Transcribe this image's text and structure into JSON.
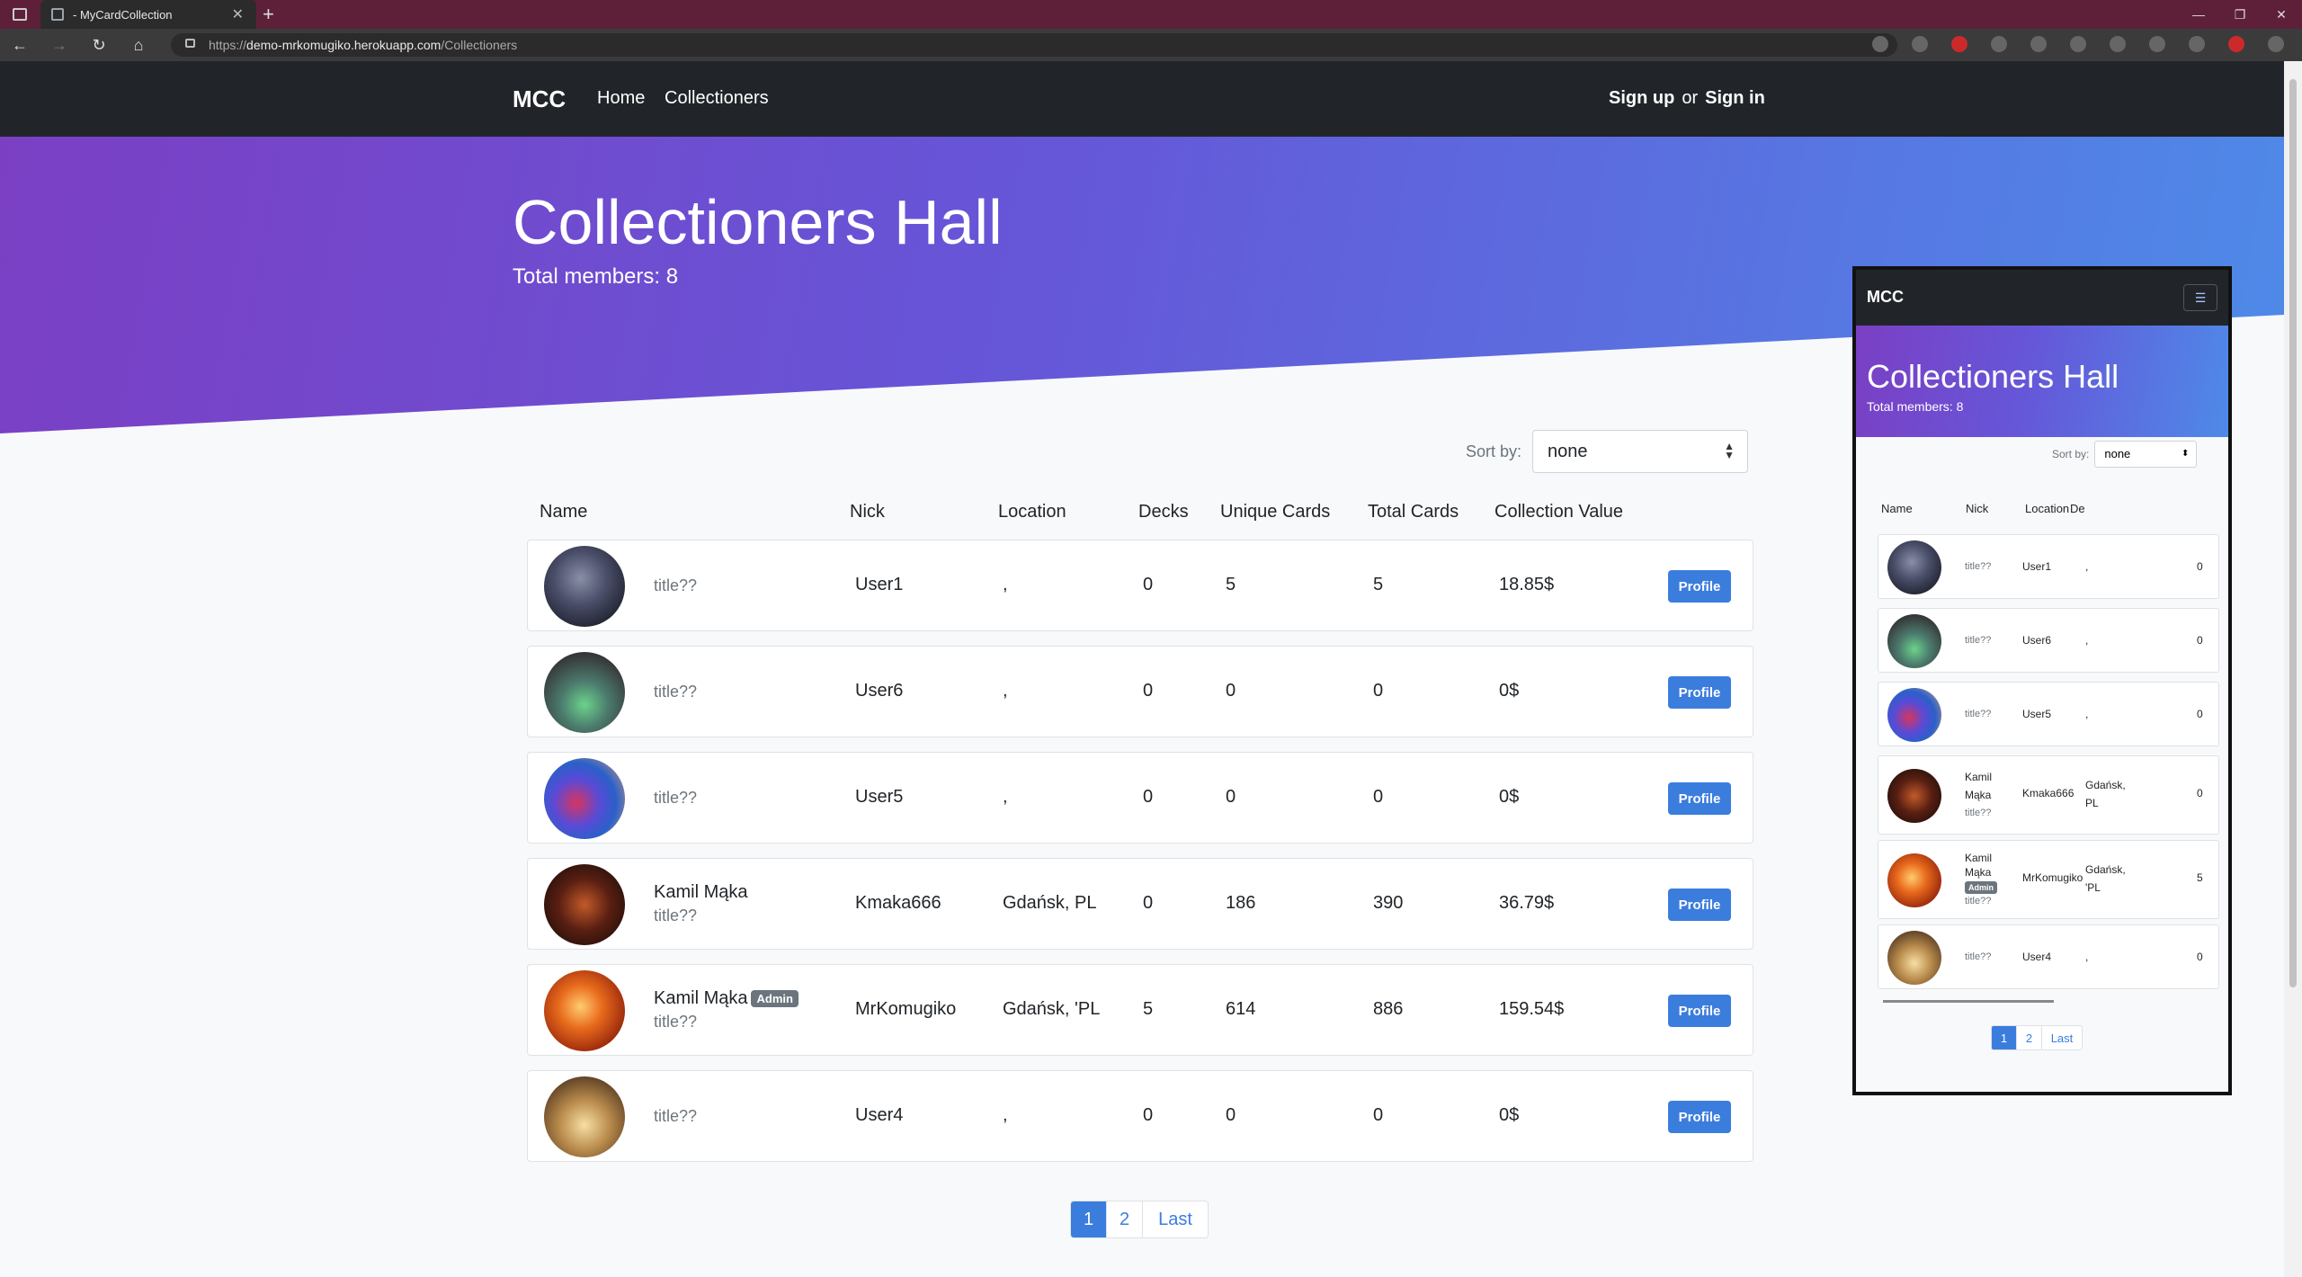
{
  "browser": {
    "tab_title": "- MyCardCollection",
    "url_prefix": "https://",
    "url_host": "demo-mrkomugiko.herokuapp.com",
    "url_path": "/Collectioners"
  },
  "navbar": {
    "brand": "MCC",
    "links": [
      "Home",
      "Collectioners"
    ],
    "sign_up": "Sign up",
    "or": "or",
    "sign_in": "Sign in"
  },
  "hero": {
    "title": "Collectioners Hall",
    "members": "Total members: 8"
  },
  "sort": {
    "label": "Sort by:",
    "value": "none"
  },
  "table": {
    "headers": [
      "Name",
      "Nick",
      "Location",
      "Decks",
      "Unique Cards",
      "Total Cards",
      "Collection Value"
    ],
    "rows": [
      {
        "name": "",
        "badge": "",
        "title": "title??",
        "nick": "User1",
        "location": ",",
        "decks": "0",
        "unique": "5",
        "total": "5",
        "value": "18.85$",
        "button": "Profile"
      },
      {
        "name": "",
        "badge": "",
        "title": "title??",
        "nick": "User6",
        "location": ",",
        "decks": "0",
        "unique": "0",
        "total": "0",
        "value": "0$",
        "button": "Profile"
      },
      {
        "name": "",
        "badge": "",
        "title": "title??",
        "nick": "User5",
        "location": ",",
        "decks": "0",
        "unique": "0",
        "total": "0",
        "value": "0$",
        "button": "Profile"
      },
      {
        "name": "Kamil Mąka",
        "badge": "",
        "title": "title??",
        "nick": "Kmaka666",
        "location": "Gdańsk, PL",
        "decks": "0",
        "unique": "186",
        "total": "390",
        "value": "36.79$",
        "button": "Profile"
      },
      {
        "name": "Kamil Mąka",
        "badge": "Admin",
        "title": "title??",
        "nick": "MrKomugiko",
        "location": "Gdańsk, 'PL",
        "decks": "5",
        "unique": "614",
        "total": "886",
        "value": "159.54$",
        "button": "Profile"
      },
      {
        "name": "",
        "badge": "",
        "title": "title??",
        "nick": "User4",
        "location": ",",
        "decks": "0",
        "unique": "0",
        "total": "0",
        "value": "0$",
        "button": "Profile"
      }
    ]
  },
  "pager": [
    "1",
    "2",
    "Last"
  ],
  "mobile": {
    "brand": "MCC",
    "title": "Collectioners Hall",
    "members": "Total members: 8",
    "sort_label": "Sort by:",
    "sort_value": "none",
    "headers": [
      "Name",
      "Nick",
      "Location",
      "De"
    ],
    "rows": [
      {
        "name1": "",
        "name2": "",
        "badge": "",
        "title": "title??",
        "nick": "User1",
        "loc1": ",",
        "loc2": "",
        "decks": "0"
      },
      {
        "name1": "",
        "name2": "",
        "badge": "",
        "title": "title??",
        "nick": "User6",
        "loc1": ",",
        "loc2": "",
        "decks": "0"
      },
      {
        "name1": "",
        "name2": "",
        "badge": "",
        "title": "title??",
        "nick": "User5",
        "loc1": ",",
        "loc2": "",
        "decks": "0"
      },
      {
        "name1": "Kamil",
        "name2": "Mąka",
        "badge": "",
        "title": "title??",
        "nick": "Kmaka666",
        "loc1": "Gdańsk,",
        "loc2": "PL",
        "decks": "0"
      },
      {
        "name1": "Kamil",
        "name2": "Mąka",
        "badge": "Admin",
        "title": "title??",
        "nick": "MrKomugiko",
        "loc1": "Gdańsk,",
        "loc2": "'PL",
        "decks": "5"
      },
      {
        "name1": "",
        "name2": "",
        "badge": "",
        "title": "title??",
        "nick": "User4",
        "loc1": ",",
        "loc2": "",
        "decks": "0"
      }
    ],
    "pager": [
      "1",
      "2",
      "Last"
    ]
  }
}
